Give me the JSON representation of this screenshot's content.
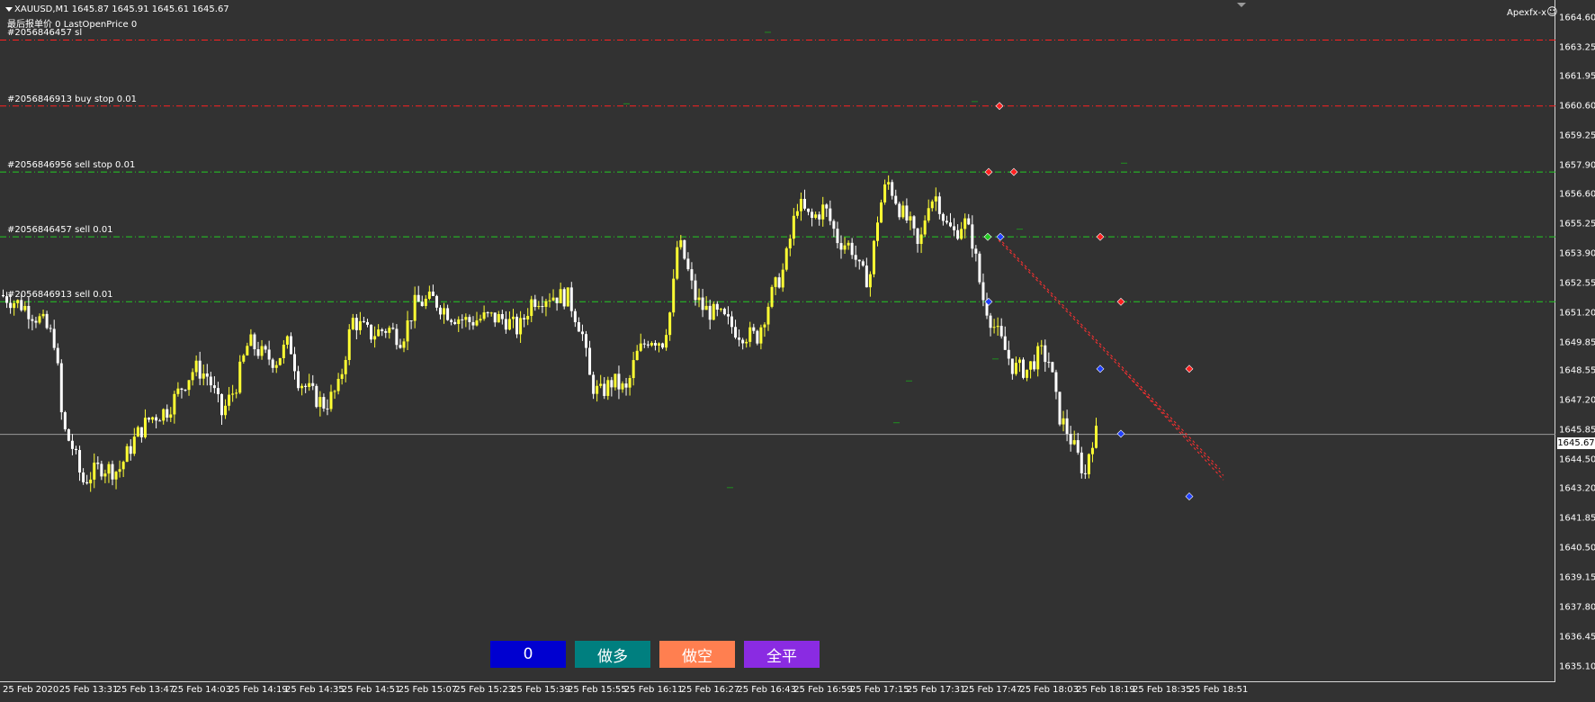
{
  "header": {
    "symbol_line": "XAUUSD,M1  1645.87 1645.91 1645.61 1645.67",
    "info_line": "最后报单价 0 LastOpenPrice 0",
    "brand": "Apexfx-x",
    "smiley": "☺"
  },
  "order_lines": [
    {
      "text": "#2056846457 sl",
      "price": 1663.6,
      "color": "#ff2020"
    },
    {
      "text": "#2056846913 buy stop 0.01",
      "price": 1660.6,
      "color": "#ff2020"
    },
    {
      "text": "#2056846956 sell stop 0.01",
      "price": 1657.6,
      "color": "#22cc22"
    },
    {
      "text": "#2056846457 sell 0.01",
      "price": 1654.65,
      "color": "#22cc22"
    },
    {
      "text": "#2056846913 sell 0.01",
      "price": 1651.7,
      "color": "#22cc22"
    }
  ],
  "price_axis": {
    "ticks": [
      "1664.60",
      "1663.25",
      "1661.95",
      "1660.60",
      "1659.25",
      "1657.90",
      "1656.60",
      "1655.25",
      "1653.90",
      "1652.55",
      "1651.20",
      "1649.85",
      "1648.55",
      "1647.20",
      "1645.85",
      "1644.50",
      "1643.20",
      "1641.85",
      "1640.50",
      "1639.15",
      "1637.80",
      "1636.45",
      "1635.10"
    ],
    "current_price": "1645.67"
  },
  "time_axis": [
    "25 Feb 2020",
    "25 Feb 13:31",
    "25 Feb 13:47",
    "25 Feb 14:03",
    "25 Feb 14:19",
    "25 Feb 14:35",
    "25 Feb 14:51",
    "25 Feb 15:07",
    "25 Feb 15:23",
    "25 Feb 15:39",
    "25 Feb 15:55",
    "25 Feb 16:11",
    "25 Feb 16:27",
    "25 Feb 16:43",
    "25 Feb 16:59",
    "25 Feb 17:15",
    "25 Feb 17:31",
    "25 Feb 17:47",
    "25 Feb 18:03",
    "25 Feb 18:19",
    "25 Feb 18:35",
    "25 Feb 18:51"
  ],
  "buttons": [
    {
      "label": "0",
      "color": "#0000d0"
    },
    {
      "label": "做多",
      "color": "#007f7f"
    },
    {
      "label": "做空",
      "color": "#ff7f50"
    },
    {
      "label": "全平",
      "color": "#8a2be2"
    }
  ],
  "chart_data": {
    "type": "candlestick",
    "symbol": "XAUUSD",
    "timeframe": "M1",
    "ylim": [
      1635.1,
      1664.6
    ],
    "price_path": [
      [
        0,
        1652.0
      ],
      [
        25,
        1651.5
      ],
      [
        45,
        1650.8
      ],
      [
        60,
        1649.9
      ],
      [
        68,
        1646.0
      ],
      [
        80,
        1645.0
      ],
      [
        90,
        1643.5
      ],
      [
        110,
        1644.2
      ],
      [
        130,
        1644.0
      ],
      [
        150,
        1645.6
      ],
      [
        165,
        1646.4
      ],
      [
        185,
        1646.8
      ],
      [
        200,
        1647.8
      ],
      [
        215,
        1648.7
      ],
      [
        230,
        1648.3
      ],
      [
        245,
        1646.6
      ],
      [
        260,
        1647.8
      ],
      [
        275,
        1649.9
      ],
      [
        290,
        1649.3
      ],
      [
        305,
        1649.0
      ],
      [
        320,
        1649.9
      ],
      [
        330,
        1648.2
      ],
      [
        350,
        1647.3
      ],
      [
        360,
        1647.0
      ],
      [
        375,
        1647.8
      ],
      [
        390,
        1650.9
      ],
      [
        410,
        1650.2
      ],
      [
        430,
        1650.5
      ],
      [
        445,
        1650.0
      ],
      [
        460,
        1651.6
      ],
      [
        480,
        1651.8
      ],
      [
        500,
        1651.1
      ],
      [
        520,
        1650.8
      ],
      [
        540,
        1651.0
      ],
      [
        560,
        1650.9
      ],
      [
        575,
        1650.4
      ],
      [
        590,
        1651.8
      ],
      [
        610,
        1652.0
      ],
      [
        630,
        1651.9
      ],
      [
        645,
        1650.4
      ],
      [
        655,
        1648.0
      ],
      [
        665,
        1647.5
      ],
      [
        680,
        1648.1
      ],
      [
        695,
        1647.6
      ],
      [
        705,
        1649.2
      ],
      [
        720,
        1650.1
      ],
      [
        735,
        1649.9
      ],
      [
        745,
        1651.5
      ],
      [
        752,
        1654.5
      ],
      [
        760,
        1653.6
      ],
      [
        770,
        1652.0
      ],
      [
        780,
        1651.4
      ],
      [
        800,
        1651.0
      ],
      [
        820,
        1650.3
      ],
      [
        840,
        1650.1
      ],
      [
        855,
        1651.9
      ],
      [
        870,
        1653.2
      ],
      [
        885,
        1656.2
      ],
      [
        900,
        1655.4
      ],
      [
        915,
        1656.0
      ],
      [
        930,
        1654.5
      ],
      [
        945,
        1654.2
      ],
      [
        955,
        1653.0
      ],
      [
        965,
        1652.7
      ],
      [
        975,
        1655.8
      ],
      [
        985,
        1657.2
      ],
      [
        992,
        1656.6
      ],
      [
        1000,
        1655.8
      ],
      [
        1010,
        1655.2
      ],
      [
        1020,
        1654.0
      ],
      [
        1030,
        1656.3
      ],
      [
        1040,
        1656.5
      ],
      [
        1050,
        1655.2
      ],
      [
        1060,
        1654.8
      ],
      [
        1070,
        1655.4
      ],
      [
        1080,
        1654.4
      ],
      [
        1090,
        1652.0
      ],
      [
        1100,
        1650.9
      ],
      [
        1110,
        1650.0
      ],
      [
        1125,
        1648.7
      ],
      [
        1140,
        1648.6
      ],
      [
        1155,
        1649.4
      ],
      [
        1165,
        1649.0
      ],
      [
        1175,
        1646.6
      ],
      [
        1185,
        1645.8
      ],
      [
        1195,
        1644.8
      ],
      [
        1205,
        1643.8
      ],
      [
        1210,
        1645.2
      ],
      [
        1215,
        1645.7
      ]
    ],
    "trade_markers": [
      {
        "type": "sell",
        "entry": 1654.65,
        "exit": 1646.1
      },
      {
        "type": "sell",
        "entry": 1657.6,
        "exit": 1643.3
      }
    ]
  }
}
